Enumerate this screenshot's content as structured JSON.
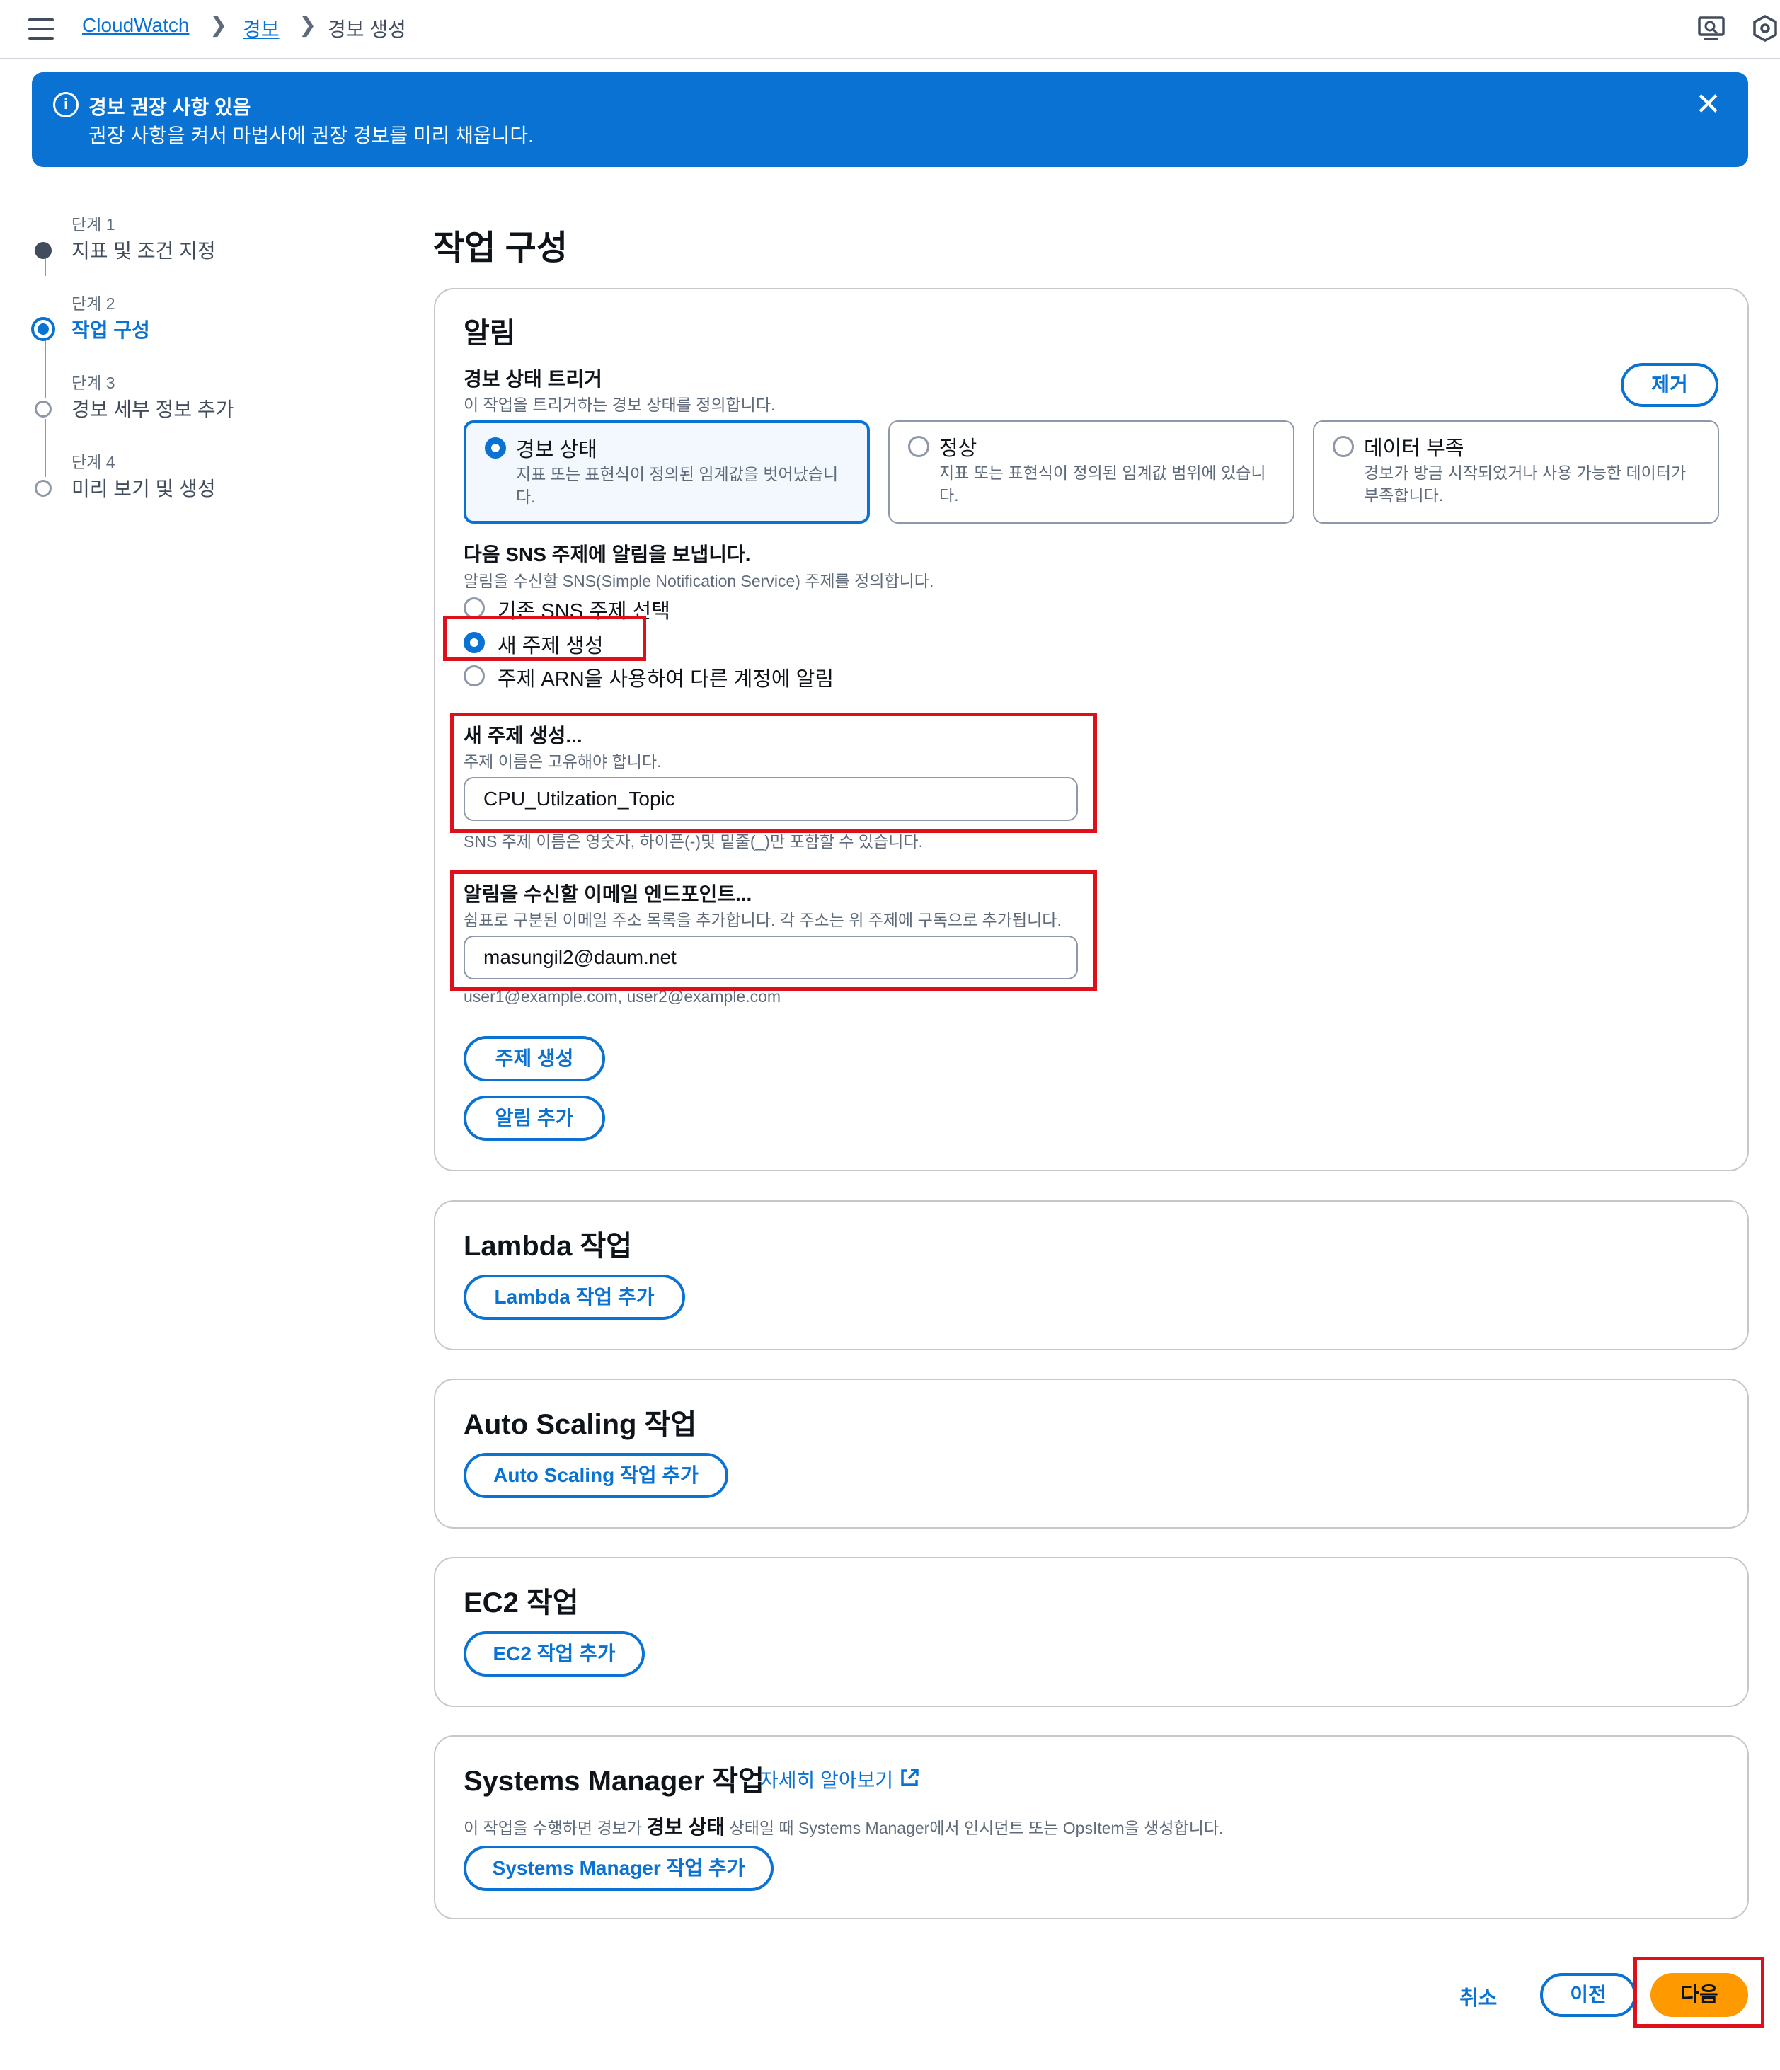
{
  "breadcrumb": {
    "root": "CloudWatch",
    "alarms": "경보",
    "current": "경보 생성"
  },
  "flash": {
    "title": "경보 권장 사항 있음",
    "body": "권장 사항을 켜서 마법사에 권장 경보를 미리 채웁니다."
  },
  "steps": [
    {
      "step": "단계 1",
      "name": "지표 및 조건 지정",
      "state": "done"
    },
    {
      "step": "단계 2",
      "name": "작업 구성",
      "state": "current"
    },
    {
      "step": "단계 3",
      "name": "경보 세부 정보 추가",
      "state": "pending"
    },
    {
      "step": "단계 4",
      "name": "미리 보기 및 생성",
      "state": "pending"
    }
  ],
  "page_title": "작업 구성",
  "notification": {
    "title": "알림",
    "trigger_label": "경보 상태 트리거",
    "trigger_desc": "이 작업을 트리거하는 경보 상태를 정의합니다.",
    "remove_button": "제거",
    "states": [
      {
        "name": "경보 상태",
        "desc": "지표 또는 표현식이 정의된 임계값을 벗어났습니다.",
        "selected": true
      },
      {
        "name": "정상",
        "desc": "지표 또는 표현식이 정의된 임계값 범위에 있습니다.",
        "selected": false
      },
      {
        "name": "데이터 부족",
        "desc": "경보가 방금 시작되었거나 사용 가능한 데이터가 부족합니다.",
        "selected": false
      }
    ],
    "sns_label": "다음 SNS 주제에 알림을 보냅니다.",
    "sns_desc": "알림을 수신할 SNS(Simple Notification Service) 주제를 정의합니다.",
    "sns_options": [
      {
        "label": "기존 SNS 주제 선택",
        "selected": false
      },
      {
        "label": "새 주제 생성",
        "selected": true
      },
      {
        "label": "주제 ARN을 사용하여 다른 계정에 알림",
        "selected": false
      }
    ],
    "topic_label": "새 주제 생성...",
    "topic_desc": "주제 이름은 고유해야 합니다.",
    "topic_value": "CPU_Utilzation_Topic",
    "topic_hint": "SNS 주제 이름은 영숫자, 하이픈(-)및 밑줄(_)만 포함할 수 있습니다.",
    "email_label": "알림을 수신할 이메일 엔드포인트...",
    "email_desc": "쉼표로 구분된 이메일 주소 목록을 추가합니다. 각 주소는 위 주제에 구독으로 추가됩니다.",
    "email_value": "masungil2@daum.net",
    "email_hint": "user1@example.com, user2@example.com",
    "create_topic_button": "주제 생성",
    "add_notification_button": "알림 추가"
  },
  "lambda": {
    "title": "Lambda 작업",
    "button": "Lambda 작업 추가"
  },
  "autoscaling": {
    "title": "Auto Scaling 작업",
    "button": "Auto Scaling 작업 추가"
  },
  "ec2": {
    "title": "EC2 작업",
    "button": "EC2 작업 추가"
  },
  "ssm": {
    "title": "Systems Manager 작업",
    "learn_more": "자세히 알아보기",
    "desc_before": "이 작업을 수행하면 경보가",
    "desc_bold": "경보 상태",
    "desc_after": "상태일 때 Systems Manager에서 인시던트 또는 OpsItem을 생성합니다.",
    "button": "Systems Manager 작업 추가"
  },
  "footer": {
    "cancel": "취소",
    "previous": "이전",
    "next": "다음"
  },
  "colors": {
    "accent": "#0972d3",
    "primary": "#ff9900",
    "highlight": "#e0101a"
  }
}
